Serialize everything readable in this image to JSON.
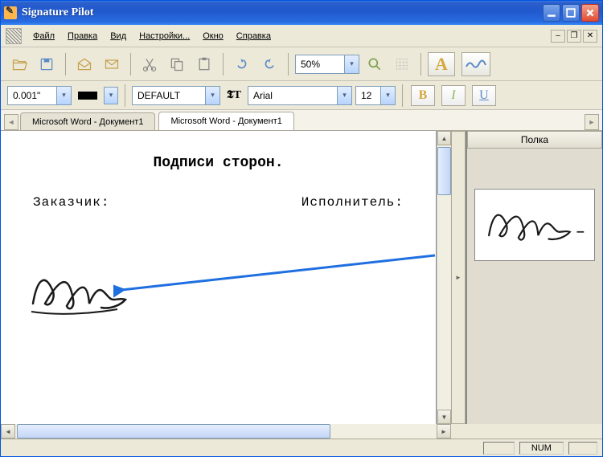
{
  "window": {
    "title": "Signature Pilot"
  },
  "menu": {
    "file": "Файл",
    "edit": "Правка",
    "view": "Вид",
    "settings": "Настройки...",
    "window": "Окно",
    "help": "Справка"
  },
  "toolbar": {
    "zoom": "50%",
    "letterA": "A",
    "lineWidth": "0.001\"",
    "fontFamilyStyle": "DEFAULT",
    "fontFamily": "Arial",
    "fontSize": "12",
    "bold": "B",
    "italic": "I",
    "underline": "U",
    "fontIconT": "T"
  },
  "tabs": {
    "tab1": "Microsoft Word - Документ1",
    "tab2": "Microsoft Word - Документ1"
  },
  "shelf": {
    "title": "Полка"
  },
  "document": {
    "heading": "Подписи сторон.",
    "leftLabel": "Заказчик:",
    "rightLabel": "Исполнитель:"
  },
  "status": {
    "num": "NUM"
  }
}
